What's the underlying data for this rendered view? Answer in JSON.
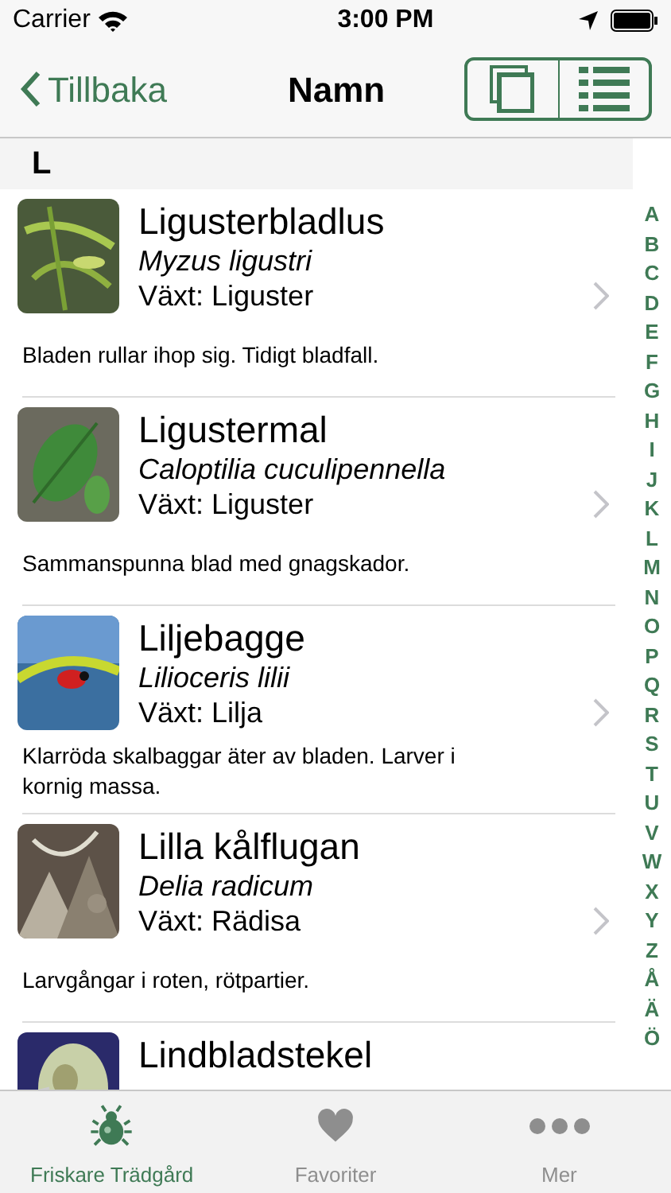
{
  "status_bar": {
    "carrier": "Carrier",
    "time": "3:00 PM"
  },
  "nav": {
    "back": "Tillbaka",
    "title": "Namn"
  },
  "section": {
    "letter": "L"
  },
  "items": [
    {
      "name": "Ligusterbladlus",
      "latin": "Myzus ligustri",
      "plant": "Växt: Liguster",
      "description": "Bladen rullar ihop sig. Tidigt bladfall."
    },
    {
      "name": "Ligustermal",
      "latin": "Caloptilia cuculipennella",
      "plant": "Växt: Liguster",
      "description": "Sammanspunna blad med gnagskador."
    },
    {
      "name": "Liljebagge",
      "latin": "Lilioceris lilii",
      "plant": "Växt: Lilja",
      "description": "Klarröda skalbaggar äter av bladen. Larver i kornig massa."
    },
    {
      "name": "Lilla kålflugan",
      "latin": "Delia radicum",
      "plant": "Växt: Rädisa",
      "description": "Larvgångar i roten, rötpartier."
    },
    {
      "name": "Lindbladstekel"
    }
  ],
  "index": [
    "A",
    "B",
    "C",
    "D",
    "E",
    "F",
    "G",
    "H",
    "I",
    "J",
    "K",
    "L",
    "M",
    "N",
    "O",
    "P",
    "Q",
    "R",
    "S",
    "T",
    "U",
    "V",
    "W",
    "X",
    "Y",
    "Z",
    "Å",
    "Ä",
    "Ö"
  ],
  "tabs": [
    {
      "label": "Friskare Trädgård",
      "selected": true,
      "kind": "bug"
    },
    {
      "label": "Favoriter",
      "selected": false,
      "kind": "heart"
    },
    {
      "label": "Mer",
      "selected": false,
      "kind": "more"
    }
  ]
}
